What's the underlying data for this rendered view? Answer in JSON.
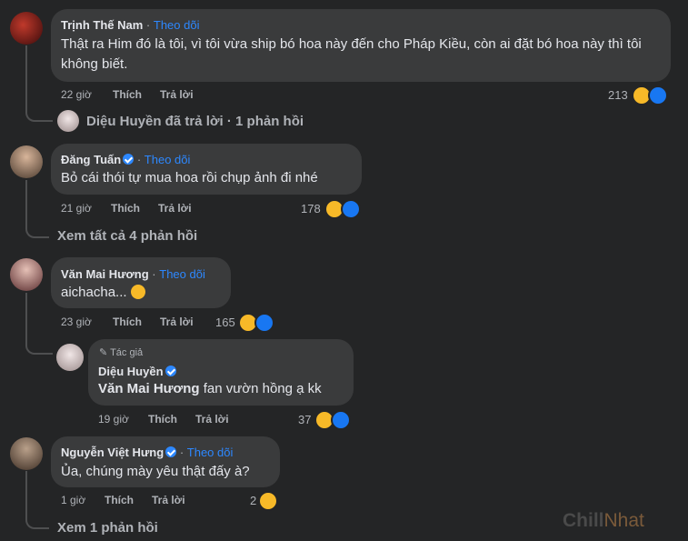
{
  "comments": [
    {
      "author": "Trịnh Thế Nam",
      "separator": "·",
      "follow": "Theo dõi",
      "text": "Thật ra Him đó là tôi, vì tôi vừa ship bó hoa này đến cho Pháp Kiều, còn ai đặt bó hoa này thì tôi không biết.",
      "time": "22 giờ",
      "like": "Thích",
      "reply": "Trả lời",
      "reactions": "213",
      "thread": "Diệu Huyền đã trả lời · 1 phản hồi"
    },
    {
      "author": "Đăng Tuấn",
      "separator": "·",
      "follow": "Theo dõi",
      "text": "Bỏ cái thói tự mua hoa rồi chụp ảnh đi nhé",
      "time": "21 giờ",
      "like": "Thích",
      "reply": "Trả lời",
      "reactions": "178",
      "thread": "Xem tất cả 4 phản hồi"
    },
    {
      "author": "Văn Mai Hương",
      "separator": "·",
      "follow": "Theo dõi",
      "text": "aichacha...",
      "time": "23 giờ",
      "like": "Thích",
      "reply": "Trả lời",
      "reactions": "165"
    },
    {
      "author": "Nguyễn Việt Hưng",
      "separator": "·",
      "follow": "Theo dõi",
      "text": "Ủa, chúng mày yêu thật đấy à?",
      "time": "1 giờ",
      "like": "Thích",
      "reply": "Trả lời",
      "reactions": "2",
      "thread": "Xem 1 phản hồi"
    }
  ],
  "reply": {
    "badge": "Tác giả",
    "author": "Diệu Huyền",
    "mention": "Văn Mai Hương",
    "text": " fan vườn hồng ạ kk",
    "time": "19 giờ",
    "like": "Thích",
    "reply": "Trả lời",
    "reactions": "37"
  },
  "watermark": {
    "part1": "Chill",
    "part2": "Nhat"
  },
  "colors": {
    "background": "#242526",
    "bubble": "#3a3b3c",
    "link": "#2d88ff",
    "meta": "#b0b3b8"
  }
}
